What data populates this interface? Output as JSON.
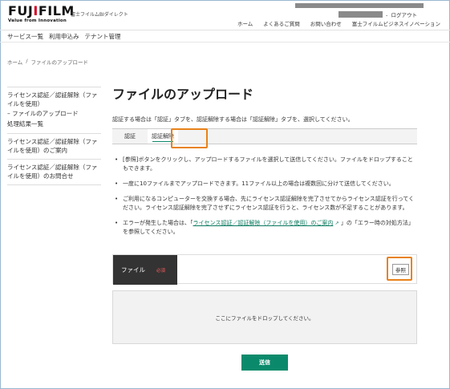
{
  "header": {
    "logo_text": "FUJIFILM",
    "logo_tagline": "Value from Innovation",
    "site_name": "富士フイルムBIダイレクト",
    "logout_sep": "-",
    "logout_label": "ログアウト",
    "util_links": [
      "ホーム",
      "よくあるご質問",
      "お問い合わせ",
      "富士フイルムビジネスイノベーション"
    ]
  },
  "global_nav": [
    "サービス一覧",
    "利用申込み",
    "テナント管理"
  ],
  "breadcrumb": {
    "home": "ホーム",
    "sep": "/",
    "current": "ファイルのアップロード"
  },
  "sidebar": {
    "block1_title": "ライセンス認証／認証解除（ファイルを使用）",
    "block1_sub1": "– ファイルのアップロード",
    "block1_sub2": "処理結果一覧",
    "block2_title": "ライセンス認証／認証解除（ファイルを使用）のご案内",
    "block3_title": "ライセンス認証／認証解除（ファイルを使用）のお問合せ"
  },
  "main": {
    "title": "ファイルのアップロード",
    "lead": "認証する場合は「認証」タブを、認証解除する場合は「認証解除」タブを、選択してください。",
    "tab_auth": "認証",
    "tab_deauth": "認証解除",
    "note1": "[参照]ボタンをクリックし、アップロードするファイルを選択して送信してください。ファイルをドロップすることもできます。",
    "note2": "一度に10ファイルまでアップロードできます。11ファイル以上の場合は複数回に分けて送信してください。",
    "note3": "ご利用になるコンピューターを交換する場合、先にライセンス認証解除を完了させてからライセンス認証を行ってください。ライセンス認証解除を完了させずにライセンス認証を行うと、ライセンス数が不足することがあります。",
    "note4_pre": "エラーが発生した場合は、「",
    "note4_link": "ライセンス認証／認証解除（ファイルを使用）のご案内",
    "note4_post": "」の「エラー時の対処方法」を参照してください。",
    "file_label": "ファイル",
    "required_label": "必須",
    "browse_label": "参照",
    "dropzone_text": "ここにファイルをドロップしてください。",
    "submit_label": "送信"
  },
  "colors": {
    "accent": "#0b8a6b",
    "highlight": "#e8821a",
    "brand_red": "#d4001e"
  }
}
